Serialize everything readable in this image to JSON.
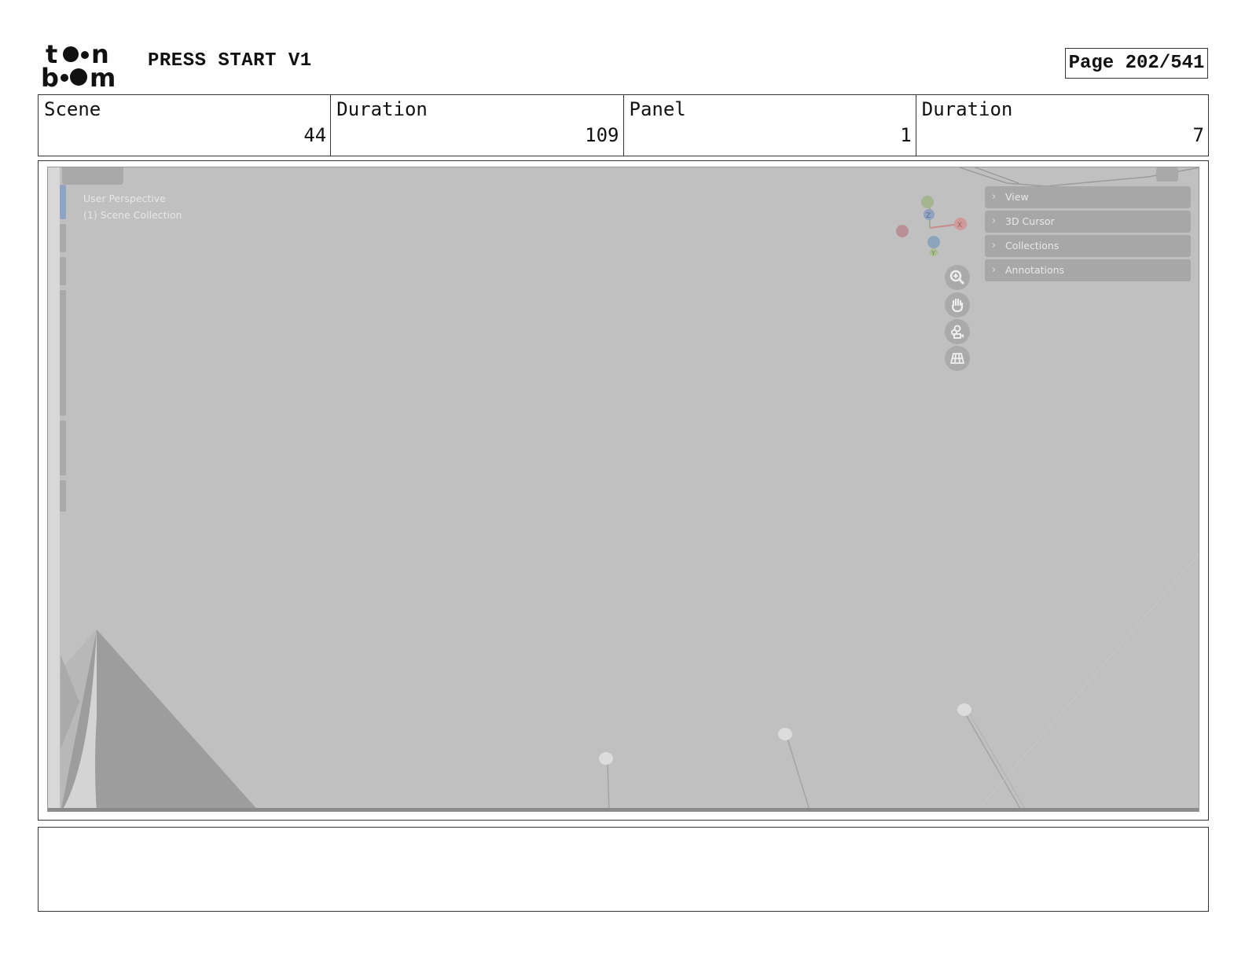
{
  "header": {
    "logo_text": "toon boom",
    "project_title": "PRESS START V1",
    "page_label": "Page 202/541"
  },
  "info": {
    "scene_label": "Scene",
    "scene_value": "44",
    "scene_duration_label": "Duration",
    "scene_duration_value": "109",
    "panel_label": "Panel",
    "panel_value": "1",
    "panel_duration_label": "Duration",
    "panel_duration_value": "7"
  },
  "viewport": {
    "perspective_label": "User Perspective",
    "collection_label": "(1) Scene Collection",
    "gizmo_axes": [
      "Z",
      "X",
      "Y"
    ],
    "sidebar_items": [
      "View",
      "3D Cursor",
      "Collections",
      "Annotations"
    ],
    "nav_buttons": [
      "zoom-icon",
      "pan-hand-icon",
      "camera-icon",
      "grid-icon"
    ],
    "background_color": "#bfc0bf"
  },
  "notes": {
    "text": ""
  }
}
